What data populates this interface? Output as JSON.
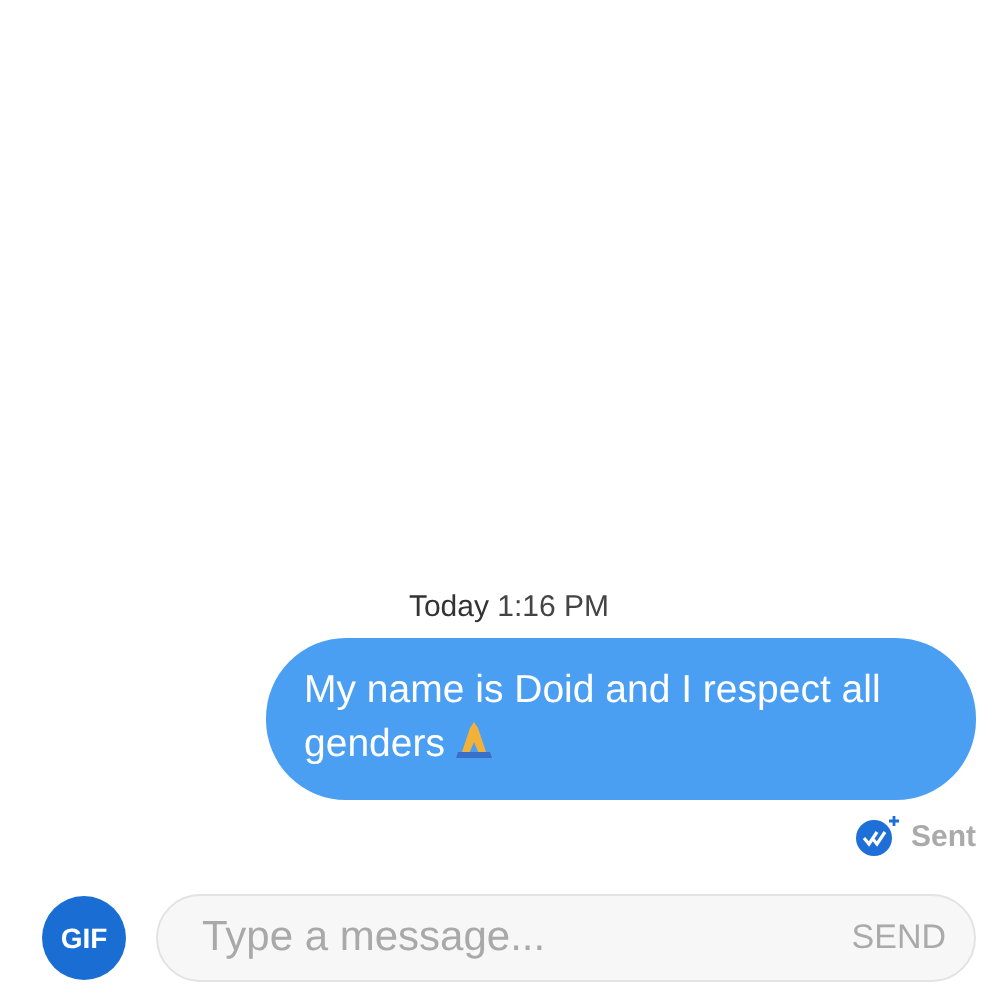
{
  "timestamp": {
    "day": "Today",
    "time": "1:16 PM"
  },
  "messages": [
    {
      "text": "My name is Doid and I respect all genders",
      "status": "Sent"
    }
  ],
  "composer": {
    "gif_label": "GIF",
    "placeholder": "Type a message...",
    "send_label": "SEND"
  }
}
